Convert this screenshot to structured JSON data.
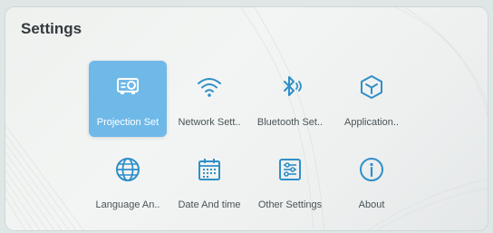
{
  "header": {
    "title": "Settings"
  },
  "tiles": [
    {
      "label": "Projection Set",
      "icon": "projector-icon",
      "selected": true
    },
    {
      "label": "Network Sett..",
      "icon": "wifi-icon",
      "selected": false
    },
    {
      "label": "Bluetooth Set..",
      "icon": "bluetooth-icon",
      "selected": false
    },
    {
      "label": "Application..",
      "icon": "cube-icon",
      "selected": false
    },
    {
      "label": "Language An..",
      "icon": "globe-icon",
      "selected": false
    },
    {
      "label": "Date And time",
      "icon": "calendar-icon",
      "selected": false
    },
    {
      "label": "Other Settings",
      "icon": "sliders-icon",
      "selected": false
    },
    {
      "label": "About",
      "icon": "info-icon",
      "selected": false
    }
  ],
  "colors": {
    "accent": "#6fb9e8",
    "icon": "#2f8fc8",
    "text": "#4a5356",
    "title": "#333a3e"
  }
}
